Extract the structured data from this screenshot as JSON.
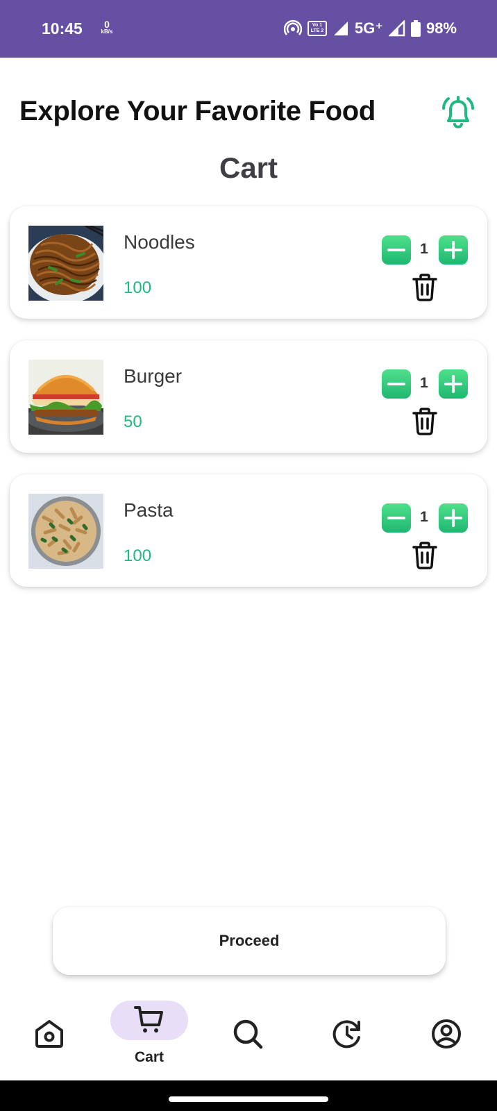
{
  "status_bar": {
    "time": "10:45",
    "speed_value": "0",
    "speed_unit": "kB/s",
    "volte_line1": "Vo 1",
    "volte_line2": "LTE 2",
    "network": "5G⁺",
    "battery": "98%",
    "icons": [
      "hotspot-icon",
      "volte-icon",
      "signal-icon",
      "signal-icon",
      "battery-icon"
    ],
    "background": "#6650a4"
  },
  "header": {
    "title": "Explore Your Favorite Food",
    "bell_icon": "bell-icon",
    "accent": "#1fb980"
  },
  "cart": {
    "title": "Cart",
    "items": [
      {
        "name": "Noodles",
        "price": "100",
        "quantity": "1"
      },
      {
        "name": "Burger",
        "price": "50",
        "quantity": "1"
      },
      {
        "name": "Pasta",
        "price": "100",
        "quantity": "1"
      }
    ]
  },
  "proceed_label": "Proceed",
  "bottom_nav": {
    "items": [
      {
        "icon": "home-icon",
        "label": ""
      },
      {
        "icon": "cart-icon",
        "label": "Cart",
        "selected": true
      },
      {
        "icon": "search-icon",
        "label": ""
      },
      {
        "icon": "history-icon",
        "label": ""
      },
      {
        "icon": "profile-icon",
        "label": ""
      }
    ],
    "selected_background": "#e8def8"
  }
}
